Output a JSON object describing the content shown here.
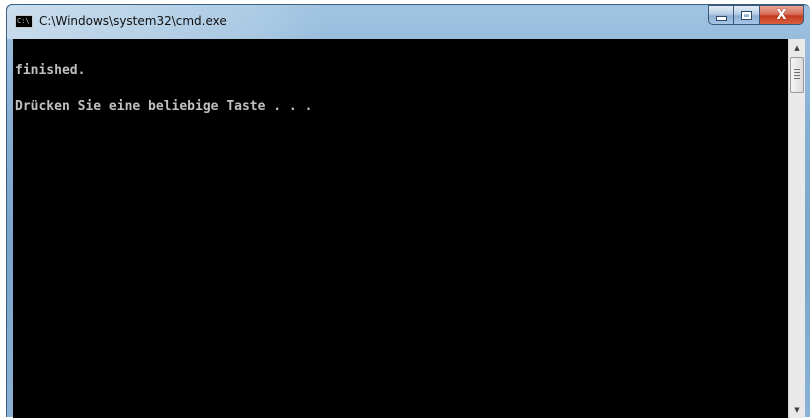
{
  "window": {
    "title": "C:\\Windows\\system32\\cmd.exe",
    "icon_label": "C:\\",
    "icons": {
      "app": "console-app-icon",
      "minimize": "minimize-icon",
      "maximize": "maximize-icon",
      "close": "close-icon"
    },
    "close_glyph": "X"
  },
  "console": {
    "lines": [
      "finished.",
      "Drücken Sie eine beliebige Taste . . ."
    ]
  },
  "scrollbar": {
    "up_glyph": "▲",
    "down_glyph": "▼"
  },
  "colors": {
    "console_background": "#000000",
    "console_text": "#c0c0c0",
    "close_button": "#c2391f"
  }
}
